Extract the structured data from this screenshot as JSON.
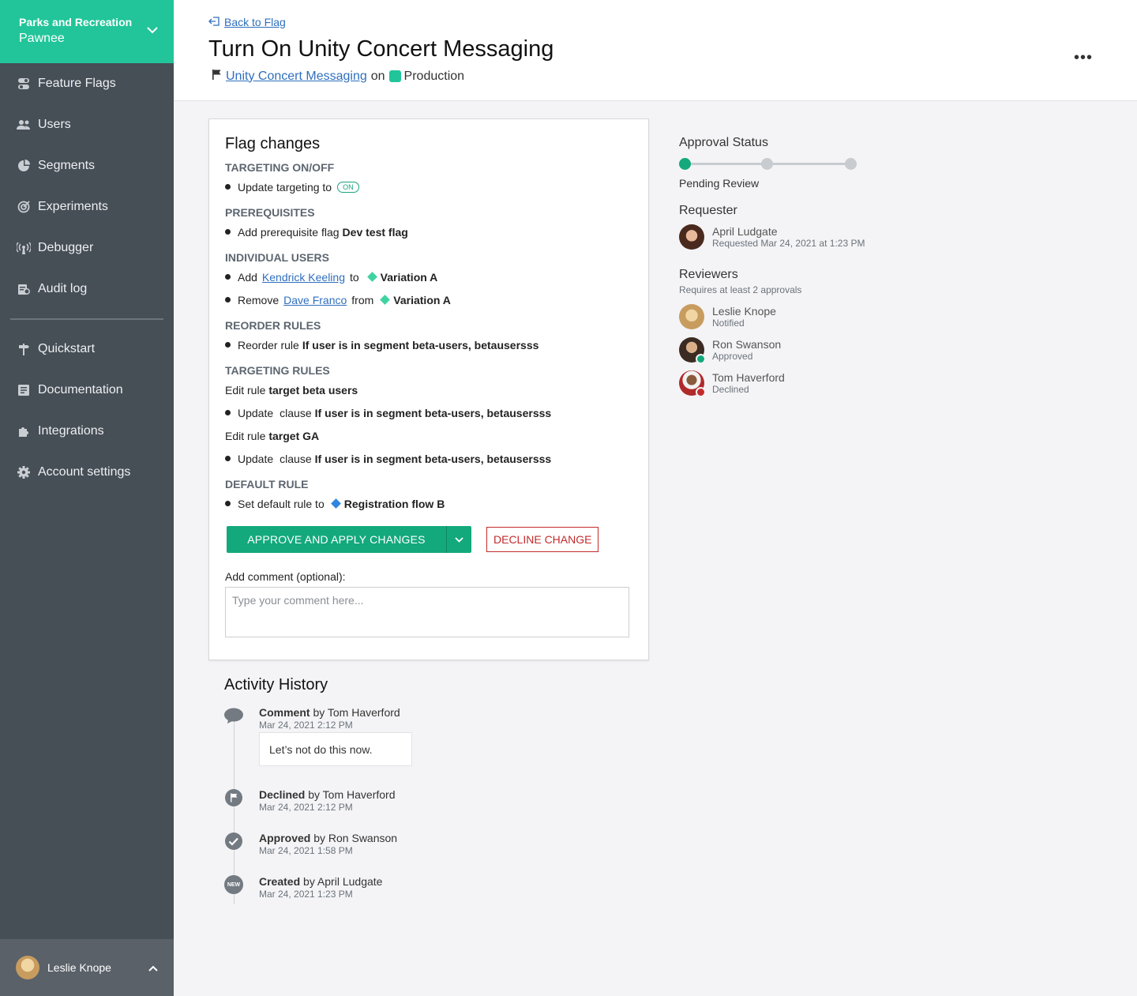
{
  "project": {
    "name": "Parks and Recreation",
    "env": "Pawnee"
  },
  "nav": {
    "items": [
      {
        "label": "Feature Flags",
        "icon": "toggle-icon"
      },
      {
        "label": "Users",
        "icon": "users-icon"
      },
      {
        "label": "Segments",
        "icon": "pie-icon"
      },
      {
        "label": "Experiments",
        "icon": "target-icon"
      },
      {
        "label": "Debugger",
        "icon": "signal-icon"
      },
      {
        "label": "Audit log",
        "icon": "audit-icon"
      }
    ],
    "items2": [
      {
        "label": "Quickstart",
        "icon": "signpost-icon"
      },
      {
        "label": "Documentation",
        "icon": "document-icon"
      },
      {
        "label": "Integrations",
        "icon": "puzzle-icon"
      },
      {
        "label": "Account settings",
        "icon": "gear-icon"
      }
    ]
  },
  "current_user": {
    "name": "Leslie Knope"
  },
  "header": {
    "back": "Back to Flag",
    "title": "Turn On Unity Concert Messaging",
    "flag": "Unity Concert Messaging",
    "on": "on",
    "environment": "Production",
    "more": "•••"
  },
  "changes": {
    "title": "Flag changes",
    "s1": "TARGETING ON/OFF",
    "r1": {
      "text": "Update targeting to",
      "pill": "ON"
    },
    "s2": "PREREQUISITES",
    "r2": {
      "a": "Add",
      "b": "prerequisite flag",
      "c": "Dev test flag"
    },
    "s3": "INDIVIDUAL USERS",
    "r3": {
      "a": "Add",
      "link": "Kendrick Keeling",
      "b": "to",
      "var": "Variation A"
    },
    "r4": {
      "a": "Remove",
      "link": "Dave Franco",
      "b": "from",
      "var": "Variation A"
    },
    "s4": "REORDER RULES",
    "r5": {
      "a": "Reorder rule",
      "b": "If user is in segment beta-users, betausersss"
    },
    "s5": "TARGETING RULES",
    "r6": {
      "a": "Edit rule",
      "b": "target beta users"
    },
    "r7": {
      "a": "Update",
      "b": "clause",
      "c": "If user is in segment beta-users, betausersss"
    },
    "r8": {
      "a": "Edit rule",
      "b": "target GA"
    },
    "r9": {
      "a": "Update",
      "b": "clause",
      "c": "If user is in segment beta-users, betausersss"
    },
    "s6": "DEFAULT RULE",
    "r10": {
      "a": "Set default rule to",
      "var": "Registration flow B"
    },
    "approve": "APPROVE AND APPLY CHANGES",
    "decline": "DECLINE CHANGE",
    "comment_label": "Add comment (optional):",
    "comment_placeholder": "Type your comment here..."
  },
  "history": {
    "title": "Activity History",
    "items": [
      {
        "action": "Comment",
        "by": "by Tom Haverford",
        "date": "Mar 24, 2021 2:12 PM",
        "icon": "comment-icon"
      },
      {
        "action": "Declined",
        "by": "by Tom Haverford",
        "date": "Mar 24, 2021 2:12 PM",
        "icon": "flag-icon"
      },
      {
        "action": "Approved",
        "by": "by Ron Swanson",
        "date": "Mar 24, 2021 1:58 PM",
        "icon": "check-icon"
      },
      {
        "action": "Created",
        "by": "by April Ludgate",
        "date": "Mar 24, 2021 1:23 PM",
        "icon": "new-icon",
        "badge": "NEW"
      }
    ],
    "comment": "Let’s not do this now."
  },
  "approval": {
    "title": "Approval Status",
    "status": "Pending Review",
    "requester_title": "Requester",
    "requester": {
      "name": "April Ludgate",
      "detail": "Requested Mar 24, 2021 at 1:23 PM"
    },
    "reviewers_title": "Reviewers",
    "reviewers_note": "Requires at least 2 approvals",
    "reviewers": [
      {
        "name": "Leslie Knope",
        "status": "Notified"
      },
      {
        "name": "Ron Swanson",
        "status": "Approved"
      },
      {
        "name": "Tom Haverford",
        "status": "Declined"
      }
    ]
  },
  "colors": {
    "accent": "#22c59a",
    "sidebar": "#464e56",
    "approve": "#13a97c",
    "decline": "#c32b2b",
    "link": "#2f6fbd",
    "variation_a": "#3fd3a2",
    "variation_b": "#2f86e0"
  }
}
